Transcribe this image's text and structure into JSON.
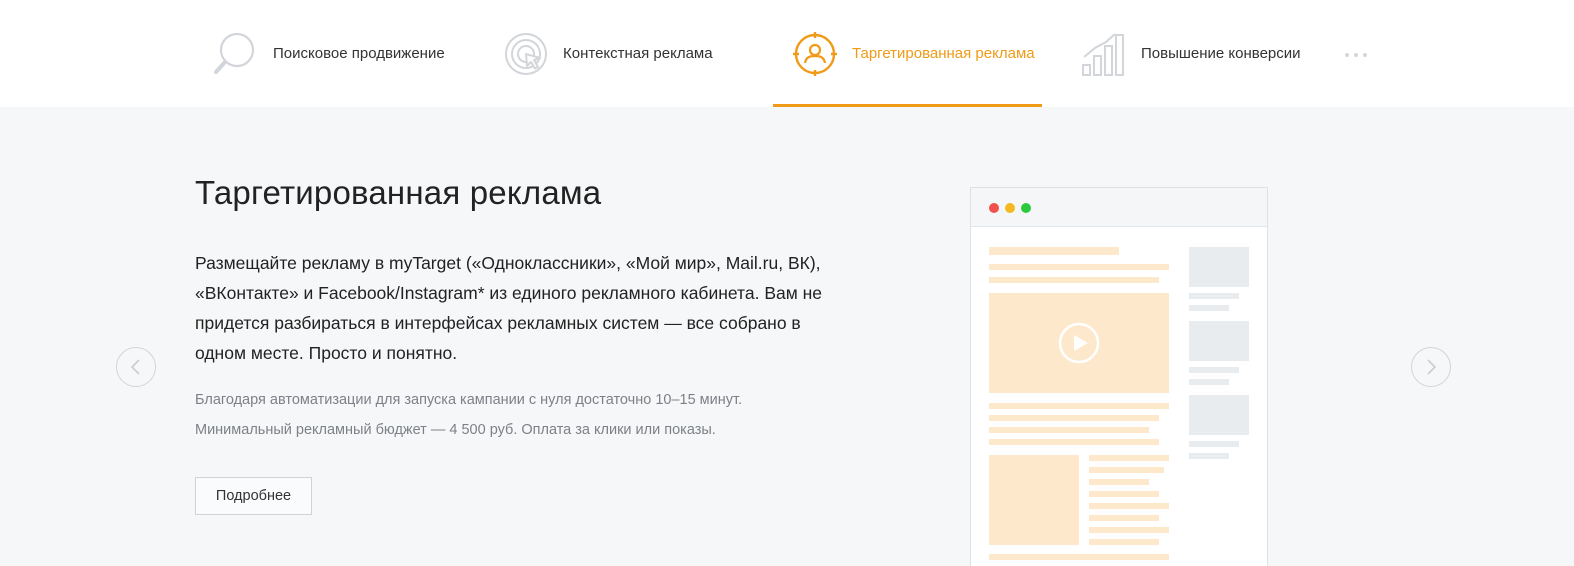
{
  "nav": {
    "tabs": [
      {
        "label": "Поисковое продвижение",
        "icon": "magnifier-icon",
        "active": false
      },
      {
        "label": "Контекстная реклама",
        "icon": "target-cursor-icon",
        "active": false
      },
      {
        "label": "Таргетированная реклама",
        "icon": "user-target-icon",
        "active": true
      },
      {
        "label": "Повышение конверсии",
        "icon": "growth-bars-icon",
        "active": false
      }
    ],
    "more_icon": "ellipsis-icon"
  },
  "slide": {
    "title": "Таргетированная реклама",
    "description": "Размещайте рекламу в myTarget («Одноклассники», «Мой мир», Mail.ru, ВК), «ВКонтакте» и Facebook/Instagram* из единого рекламного кабинета. Вам не придется разбираться в интерфейсах рекламных систем — все собрано в одном месте. Просто и понятно.",
    "note1": "Благодаря автоматизации для запуска кампании с нуля достаточно 10–15 минут.",
    "note2": "Минимальный рекламный бюджет — 4 500 руб. Оплата за клики или показы.",
    "button_label": "Подробнее"
  },
  "carousel": {
    "prev_icon": "chevron-left-icon",
    "next_icon": "chevron-right-icon"
  },
  "illustration": {
    "play_icon": "play-icon",
    "window_dots": [
      "#f1514d",
      "#f5b820",
      "#2dc93d"
    ]
  },
  "colors": {
    "accent": "#f19a17",
    "background": "#f6f7f8",
    "placeholder_orange": "#fde8cb",
    "placeholder_gray": "#e8ecee",
    "icon_gray": "#d2d5d9"
  }
}
